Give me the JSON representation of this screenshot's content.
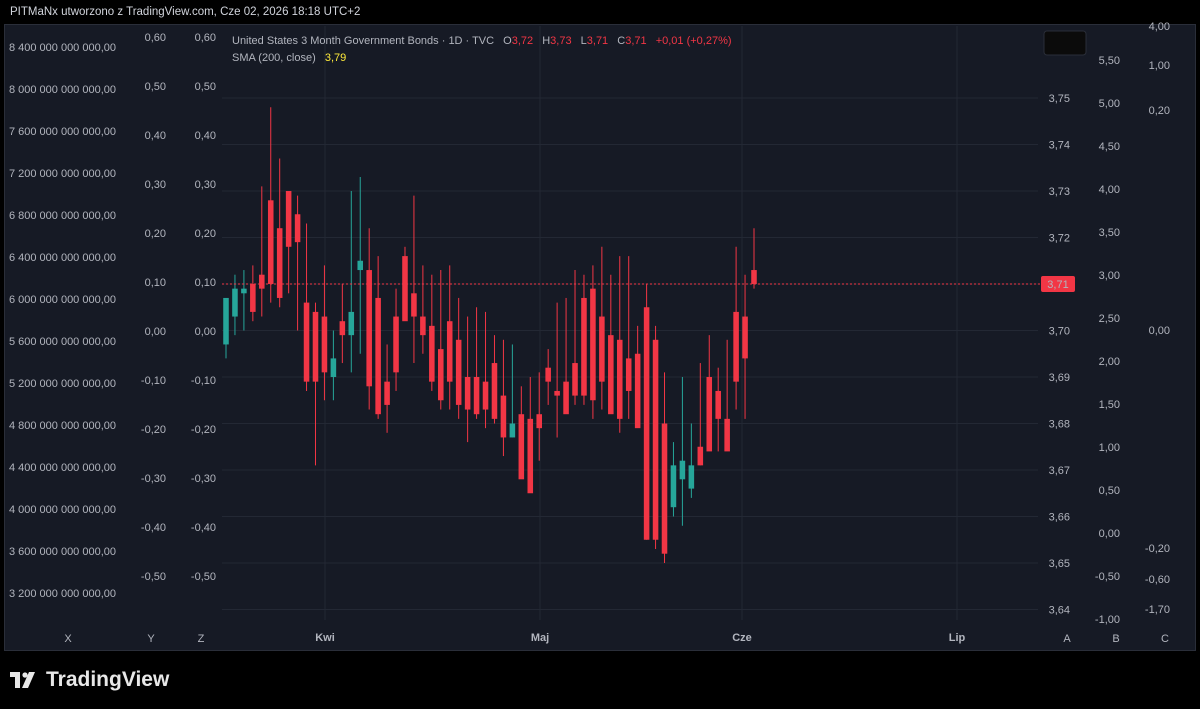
{
  "header": {
    "text": "PITMaNx utworzono z TradingView.com, Cze 02, 2026 18:18 UTC+2"
  },
  "brand": {
    "name": "TradingView"
  },
  "legend": {
    "symbol": "United States 3 Month Government Bonds · 1D · TVC",
    "o_label": "O",
    "o_value": "3,72",
    "h_label": "H",
    "h_value": "3,73",
    "l_label": "L",
    "l_value": "3,71",
    "c_label": "C",
    "c_value": "3,71",
    "change": "+0,01 (+0,27%)",
    "sma_label": "SMA (200, close)",
    "sma_value": "3,79"
  },
  "price_badge": "3,71",
  "colors": {
    "up": "#26a69a",
    "down": "#f23645",
    "sma": "#ffeb3b",
    "background": "#161a25",
    "grid": "#232834",
    "price_line": "#f23645"
  },
  "axis_buttons": {
    "left": [
      "X",
      "Y",
      "Z"
    ],
    "right": [
      "A",
      "B",
      "C"
    ]
  },
  "chart_data": {
    "type": "candlestick",
    "title": "United States 3 Month Government Bonds",
    "interval": "1D",
    "source": "TVC",
    "x_labels": [
      "Kwi",
      "Maj",
      "Cze",
      "Lip"
    ],
    "price_axis": {
      "ticks": [
        "3,75",
        "3,74",
        "3,73",
        "3,72",
        "3,71",
        "3,70",
        "3,69",
        "3,68",
        "3,67",
        "3,66",
        "3,65",
        "3,64"
      ],
      "range": [
        3.64,
        3.76
      ]
    },
    "scale_X": [
      "8 400 000 000 000,00",
      "8 000 000 000 000,00",
      "7 600 000 000 000,00",
      "7 200 000 000 000,00",
      "6 800 000 000 000,00",
      "6 400 000 000 000,00",
      "6 000 000 000 000,00",
      "5 600 000 000 000,00",
      "5 200 000 000 000,00",
      "4 800 000 000 000,00",
      "4 400 000 000 000,00",
      "4 000 000 000 000,00",
      "3 600 000 000 000,00",
      "3 200 000 000 000,00"
    ],
    "scale_Y": [
      "0,60",
      "0,50",
      "0,40",
      "0,30",
      "0,20",
      "0,10",
      "0,00",
      "-0,10",
      "-0,20",
      "-0,30",
      "-0,40",
      "-0,50"
    ],
    "scale_Z": [
      "0,60",
      "0,50",
      "0,40",
      "0,30",
      "0,20",
      "0,10",
      "0,00",
      "-0,10",
      "-0,20",
      "-0,30",
      "-0,40",
      "-0,50"
    ],
    "scale_B": [
      "5,50",
      "5,00",
      "4,50",
      "4,00",
      "3,50",
      "3,00",
      "2,50",
      "2,00",
      "1,50",
      "1,00",
      "0,50",
      "0,00",
      "-0,50",
      "-1,00"
    ],
    "scale_C": [
      "4,00",
      "1,00",
      "0,20",
      "0,00",
      "-0,20",
      "-0,60",
      "-1,70"
    ],
    "candles": [
      {
        "o": 3.697,
        "h": 3.707,
        "l": 3.694,
        "c": 3.707
      },
      {
        "o": 3.703,
        "h": 3.712,
        "l": 3.699,
        "c": 3.709
      },
      {
        "o": 3.708,
        "h": 3.713,
        "l": 3.7,
        "c": 3.709
      },
      {
        "o": 3.71,
        "h": 3.714,
        "l": 3.702,
        "c": 3.704
      },
      {
        "o": 3.712,
        "h": 3.731,
        "l": 3.703,
        "c": 3.709
      },
      {
        "o": 3.728,
        "h": 3.748,
        "l": 3.706,
        "c": 3.71
      },
      {
        "o": 3.722,
        "h": 3.737,
        "l": 3.705,
        "c": 3.707
      },
      {
        "o": 3.73,
        "h": 3.73,
        "l": 3.708,
        "c": 3.718
      },
      {
        "o": 3.725,
        "h": 3.729,
        "l": 3.7,
        "c": 3.719
      },
      {
        "o": 3.706,
        "h": 3.723,
        "l": 3.687,
        "c": 3.689
      },
      {
        "o": 3.704,
        "h": 3.706,
        "l": 3.671,
        "c": 3.689
      },
      {
        "o": 3.703,
        "h": 3.714,
        "l": 3.685,
        "c": 3.691
      },
      {
        "o": 3.69,
        "h": 3.7,
        "l": 3.685,
        "c": 3.694
      },
      {
        "o": 3.702,
        "h": 3.71,
        "l": 3.693,
        "c": 3.699
      },
      {
        "o": 3.699,
        "h": 3.73,
        "l": 3.691,
        "c": 3.704
      },
      {
        "o": 3.713,
        "h": 3.733,
        "l": 3.695,
        "c": 3.715
      },
      {
        "o": 3.713,
        "h": 3.722,
        "l": 3.683,
        "c": 3.688
      },
      {
        "o": 3.707,
        "h": 3.716,
        "l": 3.681,
        "c": 3.682
      },
      {
        "o": 3.689,
        "h": 3.697,
        "l": 3.678,
        "c": 3.684
      },
      {
        "o": 3.703,
        "h": 3.709,
        "l": 3.687,
        "c": 3.691
      },
      {
        "o": 3.716,
        "h": 3.718,
        "l": 3.703,
        "c": 3.702
      },
      {
        "o": 3.708,
        "h": 3.729,
        "l": 3.693,
        "c": 3.703
      },
      {
        "o": 3.703,
        "h": 3.714,
        "l": 3.695,
        "c": 3.699
      },
      {
        "o": 3.701,
        "h": 3.712,
        "l": 3.687,
        "c": 3.689
      },
      {
        "o": 3.696,
        "h": 3.713,
        "l": 3.683,
        "c": 3.685
      },
      {
        "o": 3.702,
        "h": 3.714,
        "l": 3.683,
        "c": 3.689
      },
      {
        "o": 3.698,
        "h": 3.707,
        "l": 3.681,
        "c": 3.684
      },
      {
        "o": 3.69,
        "h": 3.703,
        "l": 3.676,
        "c": 3.683
      },
      {
        "o": 3.69,
        "h": 3.705,
        "l": 3.681,
        "c": 3.682
      },
      {
        "o": 3.689,
        "h": 3.704,
        "l": 3.679,
        "c": 3.683
      },
      {
        "o": 3.693,
        "h": 3.699,
        "l": 3.68,
        "c": 3.681
      },
      {
        "o": 3.686,
        "h": 3.698,
        "l": 3.673,
        "c": 3.677
      },
      {
        "o": 3.677,
        "h": 3.697,
        "l": 3.677,
        "c": 3.68
      },
      {
        "o": 3.682,
        "h": 3.688,
        "l": 3.67,
        "c": 3.668
      },
      {
        "o": 3.681,
        "h": 3.69,
        "l": 3.672,
        "c": 3.665
      },
      {
        "o": 3.682,
        "h": 3.691,
        "l": 3.672,
        "c": 3.679
      },
      {
        "o": 3.692,
        "h": 3.696,
        "l": 3.684,
        "c": 3.689
      },
      {
        "o": 3.687,
        "h": 3.706,
        "l": 3.677,
        "c": 3.686
      },
      {
        "o": 3.689,
        "h": 3.707,
        "l": 3.683,
        "c": 3.682
      },
      {
        "o": 3.693,
        "h": 3.713,
        "l": 3.684,
        "c": 3.686
      },
      {
        "o": 3.707,
        "h": 3.712,
        "l": 3.684,
        "c": 3.686
      },
      {
        "o": 3.709,
        "h": 3.714,
        "l": 3.681,
        "c": 3.685
      },
      {
        "o": 3.703,
        "h": 3.718,
        "l": 3.683,
        "c": 3.689
      },
      {
        "o": 3.699,
        "h": 3.712,
        "l": 3.684,
        "c": 3.682
      },
      {
        "o": 3.698,
        "h": 3.716,
        "l": 3.678,
        "c": 3.681
      },
      {
        "o": 3.694,
        "h": 3.716,
        "l": 3.681,
        "c": 3.687
      },
      {
        "o": 3.695,
        "h": 3.701,
        "l": 3.68,
        "c": 3.679
      },
      {
        "o": 3.705,
        "h": 3.71,
        "l": 3.655,
        "c": 3.655
      },
      {
        "o": 3.698,
        "h": 3.701,
        "l": 3.653,
        "c": 3.655
      },
      {
        "o": 3.68,
        "h": 3.691,
        "l": 3.65,
        "c": 3.652
      },
      {
        "o": 3.662,
        "h": 3.676,
        "l": 3.66,
        "c": 3.671
      },
      {
        "o": 3.668,
        "h": 3.69,
        "l": 3.658,
        "c": 3.672
      },
      {
        "o": 3.666,
        "h": 3.68,
        "l": 3.664,
        "c": 3.671
      },
      {
        "o": 3.675,
        "h": 3.693,
        "l": 3.671,
        "c": 3.671
      },
      {
        "o": 3.69,
        "h": 3.699,
        "l": 3.676,
        "c": 3.674
      },
      {
        "o": 3.687,
        "h": 3.692,
        "l": 3.674,
        "c": 3.681
      },
      {
        "o": 3.681,
        "h": 3.698,
        "l": 3.676,
        "c": 3.674
      },
      {
        "o": 3.704,
        "h": 3.718,
        "l": 3.683,
        "c": 3.689
      },
      {
        "o": 3.703,
        "h": 3.712,
        "l": 3.681,
        "c": 3.694
      },
      {
        "o": 3.713,
        "h": 3.722,
        "l": 3.709,
        "c": 3.71
      }
    ],
    "last_price": 3.71,
    "sma": 3.79
  }
}
